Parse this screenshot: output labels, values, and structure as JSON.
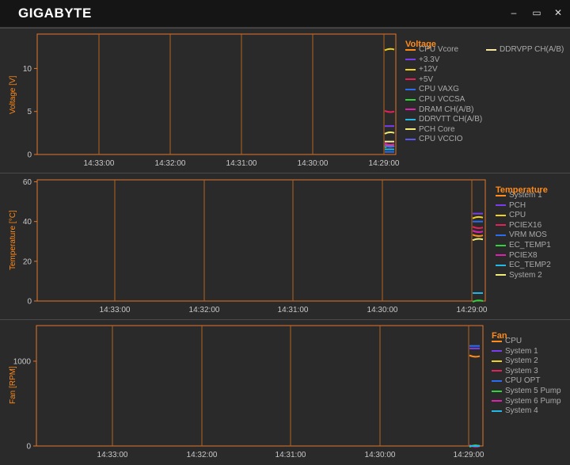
{
  "app": {
    "logo": "GIGABYTE"
  },
  "window": {
    "minimize": "–",
    "maximize": "▭",
    "close": "✕"
  },
  "voltage": {
    "ylabel": "Voltage [V]",
    "yticks": [
      "0",
      "5",
      "10"
    ],
    "ymax": 14,
    "xticks": [
      "14:33:00",
      "14:32:00",
      "14:31:00",
      "14:30:00",
      "14:29:00"
    ],
    "legend_title": "Voltage",
    "legend": [
      {
        "label": "CPU Vcore",
        "color": "#ff8c1a",
        "value": 1.0
      },
      {
        "label": "+3.3V",
        "color": "#7b3cf0",
        "value": 3.3
      },
      {
        "label": "+12V",
        "color": "#f0d21e",
        "value": 12.2
      },
      {
        "label": "+5V",
        "color": "#e8205a",
        "value": 5.0
      },
      {
        "label": "CPU VAXG",
        "color": "#2b6cf0",
        "value": 0.3
      },
      {
        "label": "CPU VCCSA",
        "color": "#2fd43a",
        "value": 0.9
      },
      {
        "label": "DRAM CH(A/B)",
        "color": "#e020b0",
        "value": 1.2
      },
      {
        "label": "DDRVTT CH(A/B)",
        "color": "#22b8e8",
        "value": 0.6
      },
      {
        "label": "PCH Core",
        "color": "#f2eb78",
        "value": 2.5
      },
      {
        "label": "CPU VCCIO",
        "color": "#5a5af0",
        "value": 0.95
      },
      {
        "label": "DDRVPP CH(A/B)",
        "color": "#f5e6a0",
        "value": 1.5
      }
    ]
  },
  "temperature": {
    "ylabel": "Temperature [°C]",
    "yticks": [
      "0",
      "20",
      "40",
      "60"
    ],
    "ymax": 61,
    "xticks": [
      "14:33:00",
      "14:32:00",
      "14:31:00",
      "14:30:00",
      "14:29:00"
    ],
    "legend_title": "Temperature",
    "legend": [
      {
        "label": "System 1",
        "color": "#ff8c1a",
        "value": 33
      },
      {
        "label": "PCH",
        "color": "#7b3cf0",
        "value": 44
      },
      {
        "label": "CPU",
        "color": "#f0d21e",
        "value": 42
      },
      {
        "label": "PCIEX16",
        "color": "#e8205a",
        "value": 37
      },
      {
        "label": "VRM MOS",
        "color": "#2b6cf0",
        "value": 40
      },
      {
        "label": "EC_TEMP1",
        "color": "#2fd43a",
        "value": 0
      },
      {
        "label": "PCIEX8",
        "color": "#e020b0",
        "value": 35
      },
      {
        "label": "EC_TEMP2",
        "color": "#22b8e8",
        "value": 4
      },
      {
        "label": "System 2",
        "color": "#f2eb78",
        "value": 31
      }
    ]
  },
  "fan": {
    "ylabel": "Fan [RPM]",
    "yticks": [
      "0",
      "1000"
    ],
    "ymax": 1420,
    "xticks": [
      "14:33:00",
      "14:32:00",
      "14:31:00",
      "14:30:00",
      "14:29:00"
    ],
    "legend_title": "Fan",
    "legend": [
      {
        "label": "CPU",
        "color": "#ff8c1a",
        "value": 1060
      },
      {
        "label": "System 1",
        "color": "#7b3cf0",
        "value": 1150
      },
      {
        "label": "System 2",
        "color": "#f0d21e",
        "value": 0
      },
      {
        "label": "System 3",
        "color": "#e8205a",
        "value": 0
      },
      {
        "label": "CPU OPT",
        "color": "#2b6cf0",
        "value": 1180
      },
      {
        "label": "System 5 Pump",
        "color": "#2fd43a",
        "value": 0
      },
      {
        "label": "System 6 Pump",
        "color": "#e020b0",
        "value": 0
      },
      {
        "label": "System 4",
        "color": "#22b8e8",
        "value": 0
      }
    ]
  }
}
